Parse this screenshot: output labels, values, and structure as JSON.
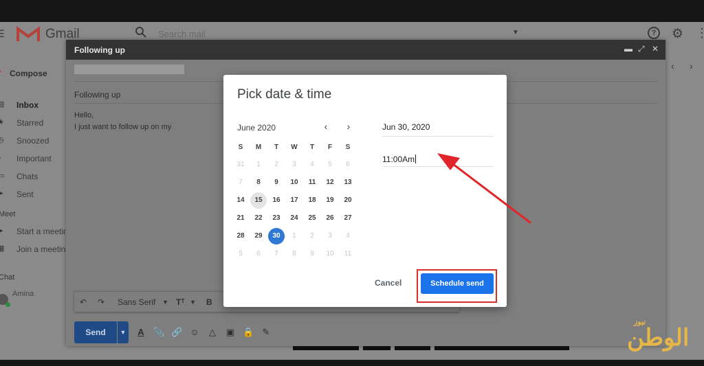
{
  "gmail": {
    "brand": "Gmail",
    "search_placeholder": "Search mail"
  },
  "sidebar": {
    "compose_label": "Compose",
    "items": [
      {
        "label": "Inbox",
        "icon": "inbox-icon",
        "bold": true
      },
      {
        "label": "Starred",
        "icon": "star-icon"
      },
      {
        "label": "Snoozed",
        "icon": "clock-icon"
      },
      {
        "label": "Important",
        "icon": "important-icon"
      },
      {
        "label": "Chats",
        "icon": "chat-icon"
      },
      {
        "label": "Sent",
        "icon": "send-icon"
      }
    ],
    "meet_section": "Meet",
    "meet_items": [
      {
        "label": "Start a meeting",
        "icon": "video-icon"
      },
      {
        "label": "Join a meeting",
        "icon": "keyboard-icon"
      }
    ],
    "chat_section": "Chat",
    "chat_user": "Amina"
  },
  "compose": {
    "window_title": "Following up",
    "subject": "Following up",
    "body_line1": "Hello,",
    "body_line2": "I just want to follow up on my",
    "font_name": "Sans Serif",
    "send_label": "Send"
  },
  "dialog": {
    "title": "Pick date & time",
    "month_label": "June 2020",
    "weekdays": [
      "S",
      "M",
      "T",
      "W",
      "T",
      "F",
      "S"
    ],
    "weeks": [
      [
        "31",
        "1",
        "2",
        "3",
        "4",
        "5",
        "6"
      ],
      [
        "7",
        "8",
        "9",
        "10",
        "11",
        "12",
        "13"
      ],
      [
        "14",
        "15",
        "16",
        "17",
        "18",
        "19",
        "20"
      ],
      [
        "21",
        "22",
        "23",
        "24",
        "25",
        "26",
        "27"
      ],
      [
        "28",
        "29",
        "30",
        "1",
        "2",
        "3",
        "4"
      ],
      [
        "5",
        "6",
        "7",
        "8",
        "9",
        "10",
        "11"
      ]
    ],
    "disabled_before": [
      0,
      8
    ],
    "disabled_after": [
      4,
      3
    ],
    "today": [
      2,
      1
    ],
    "selected": [
      4,
      2
    ],
    "date_value": "Jun 30, 2020",
    "time_value": "11:00Am",
    "cancel_label": "Cancel",
    "schedule_label": "Schedule send"
  },
  "colors": {
    "accent": "#1a73e8",
    "selected_day": "#2f78d4",
    "highlight_box": "#d93025",
    "arrow": "#e0262a",
    "watermark": "#e7b649"
  },
  "watermark": {
    "small": "نيوز",
    "big": "الوطن"
  }
}
